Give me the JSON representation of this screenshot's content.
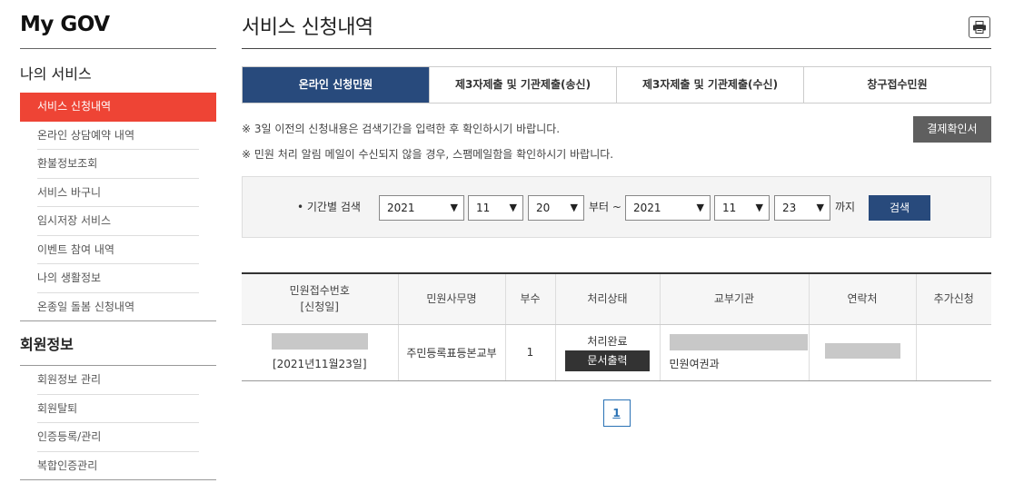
{
  "sidebar": {
    "brand": "My GOV",
    "section1": "나의 서비스",
    "items1": [
      "서비스 신청내역",
      "온라인 상담예약 내역",
      "환불정보조회",
      "서비스 바구니",
      "임시저장 서비스",
      "이벤트 참여 내역",
      "나의 생활정보",
      "온종일 돌봄 신청내역"
    ],
    "section2": "회원정보",
    "items2": [
      "회원정보 관리",
      "회원탈퇴",
      "인증등록/관리",
      "복합인증관리"
    ]
  },
  "main": {
    "title": "서비스 신청내역",
    "tabs": [
      "온라인 신청민원",
      "제3자제출 및 기관제출(송신)",
      "제3자제출 및 기관제출(수신)",
      "창구접수민원"
    ],
    "notice1": "※ 3일 이전의 신청내용은 검색기간을 입력한 후 확인하시기 바랍니다.",
    "notice2": "※ 민원 처리 알림 메일이 수신되지 않을 경우, 스팸메일함을 확인하시기 바랍니다.",
    "receipt_button": "결제확인서",
    "search": {
      "label": "• 기간별 검색",
      "from_year": "2021",
      "from_month": "11",
      "from_day": "20",
      "sep_from": "부터 ~",
      "to_year": "2021",
      "to_month": "11",
      "to_day": "23",
      "sep_to": "까지",
      "button": "검색"
    },
    "table": {
      "headers": {
        "receipt_no_l1": "민원접수번호",
        "receipt_no_l2": "[신청일]",
        "office": "민원사무명",
        "copies": "부수",
        "status": "처리상태",
        "agency": "교부기관",
        "contact": "연락처",
        "extra": "추가신청"
      },
      "rows": [
        {
          "date": "[2021년11월23일]",
          "office": "주민등록표등본교부",
          "copies": "1",
          "status": "처리완료",
          "print_button": "문서출력",
          "agency_dept": "민원여권과"
        }
      ]
    },
    "pagination": {
      "current": "1"
    }
  }
}
